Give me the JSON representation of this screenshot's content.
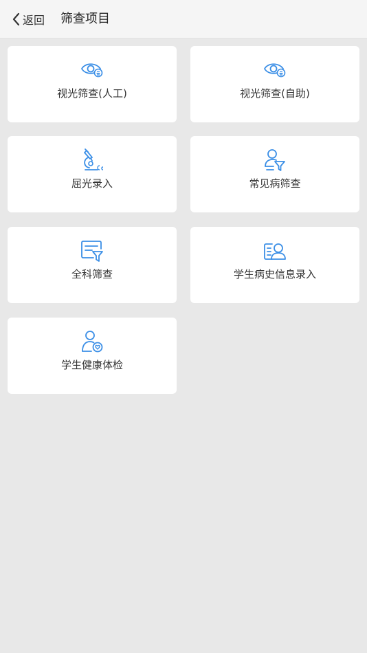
{
  "header": {
    "back_label": "返回",
    "title": "筛查项目"
  },
  "accent_color": "#3a8ee6",
  "items": [
    {
      "label": "视光筛查(人工)",
      "icon": "eye-icon"
    },
    {
      "label": "视光筛查(自助)",
      "icon": "eye-icon"
    },
    {
      "label": "屈光录入",
      "icon": "microscope-icon"
    },
    {
      "label": "常见病筛查",
      "icon": "person-filter-icon"
    },
    {
      "label": "全科筛查",
      "icon": "document-filter-icon"
    },
    {
      "label": "学生病史信息录入",
      "icon": "id-card-icon"
    },
    {
      "label": "学生健康体检",
      "icon": "person-heart-icon"
    }
  ]
}
